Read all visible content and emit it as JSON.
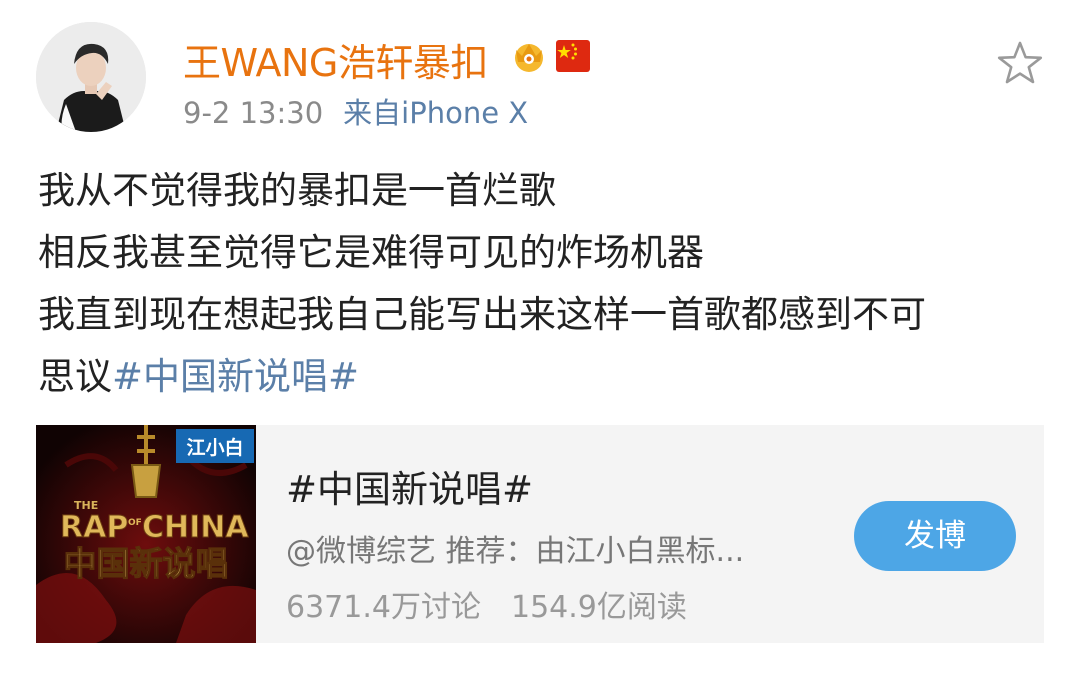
{
  "post": {
    "author": "王WANG浩轩暴扣",
    "time": "9-2 13:30",
    "source": "来自iPhone X",
    "lines": [
      "我从不觉得我的暴扣是一首烂歌",
      "相反我甚至觉得它是难得可见的炸场机器",
      "我直到现在想起我自己能写出来这样一首歌都感到不可"
    ],
    "last_line_text": "思议",
    "hashtag": "#中国新说唱#"
  },
  "icons": {
    "favorite": "star-outline-icon",
    "badge": "crown-badge-icon",
    "flag": "china-flag-icon"
  },
  "topic_card": {
    "title": "#中国新说唱#",
    "description": "@微博综艺 推荐：由江小白黑标...",
    "discussions": "6371.4万讨论",
    "reads": "154.9亿阅读",
    "button_label": "发博",
    "thumbnail": {
      "sponsor": "江小白",
      "show_top": "THE",
      "show_en_1": "RAP",
      "show_en_of": "OF",
      "show_en_2": "CHINA",
      "show_cn": "中国新说唱"
    }
  },
  "colors": {
    "username": "#e8730f",
    "link": "#5b7fa8",
    "button": "#4da6e6",
    "card_bg": "#f4f4f4"
  }
}
